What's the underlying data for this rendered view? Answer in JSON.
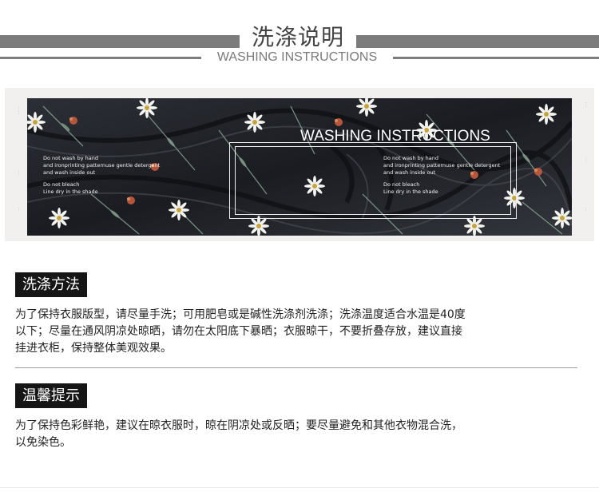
{
  "header": {
    "title_cn": "洗涤说明",
    "title_en": "WASHING INSTRUCTIONS"
  },
  "banner": {
    "title": "WASHING INSTRUCTIONS",
    "left_lines": [
      "Do not wash by hand",
      "and ironprinting patternuse gentle detergent",
      "and wash inside out",
      "Do not bleach",
      "Line dry in the shade"
    ],
    "right_lines": [
      "Do not wash by hand",
      "and ironprinting patternuse gentle detergent",
      "and wash inside out",
      "Do not bleach",
      "Line dry in the shade"
    ]
  },
  "section1": {
    "tag": "洗涤方法",
    "lines": [
      "为了保持衣服版型，请尽量手洗；可用肥皂或是碱性洗涤剂洗涤；洗涤温度适合水温是40度",
      "以下；尽量在通风阴凉处晾晒，请勿在太阳底下暴晒；衣服晾干，不要折叠存放，建议直接",
      "挂进衣柜，保持整体美观效果。"
    ]
  },
  "section2": {
    "tag": "温馨提示",
    "lines": [
      "为了保持色彩鲜艳，建议在晾衣服时，晾在阴凉处或反晒；要尽量避免和其他衣物混合洗，",
      "以免染色。"
    ]
  },
  "colors": {
    "bar_gray": "#7c7c7c",
    "tag_bg": "#161616",
    "fabric": "#1d1f24"
  }
}
